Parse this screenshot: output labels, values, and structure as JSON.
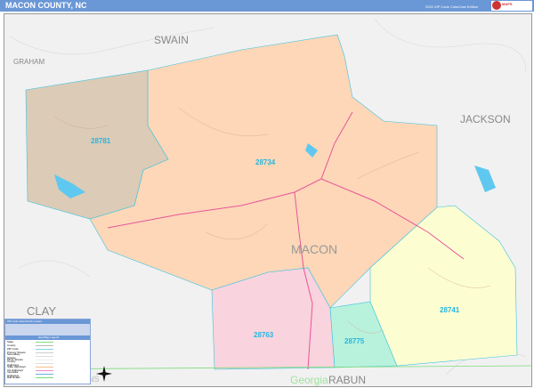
{
  "header": {
    "title": "MACON COUNTY, NC",
    "edition": "2022 ZIP Code ColorCast Edition",
    "logo": "Market MAPS"
  },
  "map": {
    "neighbors": [
      "SWAIN",
      "GRAHAM",
      "JACKSON",
      "CLAY",
      "RABUN"
    ],
    "county_label": "MACON",
    "state_label": "Georgia",
    "partial_label": "NS",
    "zip_areas": [
      {
        "zip": "28781",
        "color": "#dccbb6"
      },
      {
        "zip": "28734",
        "color": "#fdd7b8"
      },
      {
        "zip": "28763",
        "color": "#f9d3dd"
      },
      {
        "zip": "28775",
        "color": "#b8f2dc"
      },
      {
        "zip": "28741",
        "color": "#fdfdd2"
      }
    ],
    "colors": {
      "highway": "#e8559a",
      "water": "#5ec8f0",
      "zip_border": "#3cc3e0"
    }
  },
  "legend": {
    "title": "ZIP Code Select/Grid Locator",
    "section": "Hwy/Map Legend",
    "items": [
      "State",
      "County",
      "ZIP Code",
      "Primary Streets",
      "Secondary Streets",
      "Minor Streets",
      "County Highways",
      "State Highways",
      "US Highways",
      "Interstate Highways",
      "Rail Roads"
    ],
    "item_colors": [
      "#7ddc7d",
      "#bbbbbb",
      "#7fd3ef",
      "#cccccc",
      "#dddddd",
      "#eeeeee",
      "#dddddd",
      "#f5c08a",
      "#f08cc0",
      "#6ab0e8",
      "#77dd77"
    ]
  }
}
